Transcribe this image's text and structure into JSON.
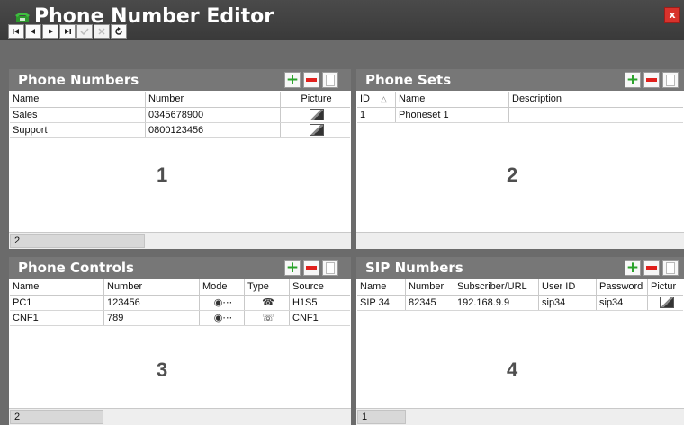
{
  "app": {
    "title": "Phone Number Editor",
    "icon": "phone-icon",
    "close_label": "x"
  },
  "navigator": {
    "buttons": [
      "first",
      "prior",
      "next",
      "last",
      "post",
      "cancel",
      "refresh"
    ]
  },
  "panels": {
    "phone_numbers": {
      "title": "Phone Numbers",
      "columns": [
        "Name",
        "Number",
        "Picture"
      ],
      "rows": [
        {
          "name": "Sales",
          "number": "0345678900"
        },
        {
          "name": "Support",
          "number": "0800123456"
        }
      ],
      "marker": "1",
      "count": "2"
    },
    "phone_sets": {
      "title": "Phone Sets",
      "columns": [
        "ID",
        "Name",
        "Description"
      ],
      "rows": [
        {
          "id": "1",
          "name": "Phoneset 1",
          "description": ""
        }
      ],
      "marker": "2"
    },
    "phone_controls": {
      "title": "Phone Controls",
      "columns": [
        "Name",
        "Number",
        "Mode",
        "Type",
        "Source"
      ],
      "rows": [
        {
          "name": "PC1",
          "number": "123456",
          "mode": "◉⋯",
          "type": "☎",
          "source": "H1S5"
        },
        {
          "name": "CNF1",
          "number": "789",
          "mode": "◉⋯",
          "type": "☏",
          "source": "CNF1"
        }
      ],
      "marker": "3",
      "count": "2"
    },
    "sip_numbers": {
      "title": "SIP Numbers",
      "columns": [
        "Name",
        "Number",
        "Subscriber/URL",
        "User ID",
        "Password",
        "Pictur"
      ],
      "rows": [
        {
          "name": "SIP 34",
          "number": "82345",
          "url": "192.168.9.9",
          "user_id": "sip34",
          "password": "sip34"
        }
      ],
      "marker": "4",
      "count": "1"
    }
  }
}
